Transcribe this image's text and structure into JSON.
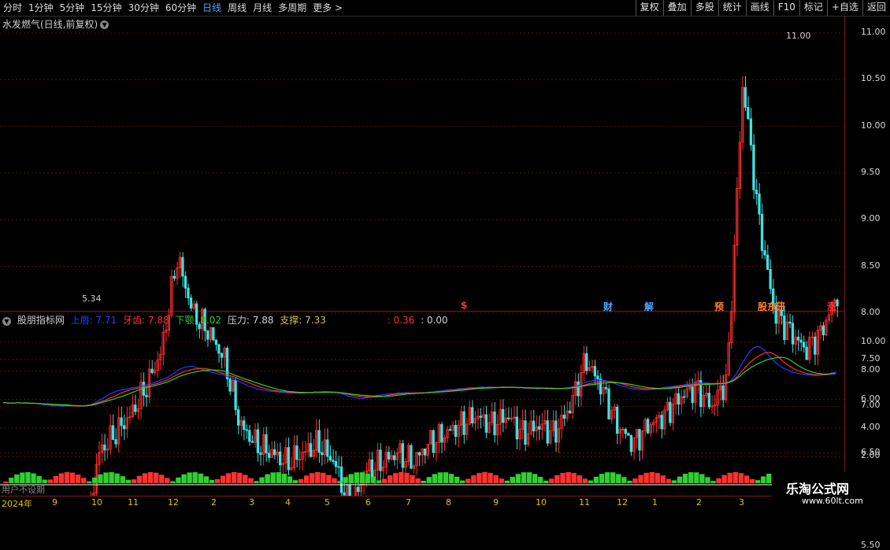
{
  "toolbar": {
    "periods": [
      "分时",
      "1分钟",
      "5分钟",
      "15分钟",
      "30分钟",
      "60分钟",
      "日线",
      "周线",
      "月线",
      "多周期",
      "更多 >"
    ],
    "active_period": "日线",
    "actions": [
      "复权",
      "叠加",
      "多股",
      "统计",
      "画线",
      "F10",
      "标记",
      "+自选",
      "返回"
    ]
  },
  "kline": {
    "title": "水发燃气(日线,前复权)",
    "high_label": "11.00",
    "low_label": "5.34",
    "y_ticks": [
      "11.00",
      "10.50",
      "10.00",
      "9.50",
      "9.00",
      "8.50",
      "8.00",
      "7.50",
      "7.00",
      "6.50",
      "6.00",
      "5.50"
    ],
    "markers": [
      {
        "text": "$",
        "color": "#ff3030"
      },
      {
        "text": "财",
        "color": "#4aa8ff"
      },
      {
        "text": "解",
        "color": "#4aa8ff"
      },
      {
        "text": "预",
        "color": "#ff8030"
      },
      {
        "text": "股东",
        "color": "#ff8030"
      },
      {
        "text": "研",
        "color": "#ff8030"
      },
      {
        "text": "涨",
        "color": "#ff3030"
      }
    ]
  },
  "indicator": {
    "name": "股朋指标网",
    "upper_lip_label": "上唇: 7.71",
    "teeth_label": "牙齿: 7.88",
    "lower_jaw_label": "下颚: 8.02",
    "pressure_label": "压力: 7.88",
    "support_label": "支撑: 7.33",
    "value1_label": ": 0.36",
    "value2_label": ": 0.00",
    "y_ticks": [
      "10.00",
      "8.00",
      "6.00",
      "4.00",
      "2.00"
    ],
    "colors": {
      "upper_lip": "#2040ff",
      "teeth": "#ff3030",
      "lower_jaw": "#30d030",
      "pressure": "#d0d0d0",
      "support": "#d0c060"
    }
  },
  "lower_left_text": "用户不设期",
  "date_axis": [
    "2024年",
    "9",
    "10",
    "11",
    "12",
    "2",
    "3",
    "4",
    "5",
    "6",
    "7",
    "8",
    "9",
    "10",
    "11",
    "12",
    "1",
    "2",
    "3"
  ],
  "watermark": {
    "title": "乐淘公式网",
    "url": "www.60lt.com"
  },
  "chart_data": {
    "type": "candlestick",
    "title": "水发燃气(日线,前复权)",
    "ylim": [
      5.3,
      11.2
    ],
    "highest": 11.0,
    "lowest": 5.34,
    "close_series_approx": [
      5.7,
      5.8,
      5.6,
      5.5,
      5.6,
      5.45,
      6.5,
      6.7,
      6.9,
      7.2,
      7.6,
      8.6,
      8.0,
      7.8,
      7.5,
      6.8,
      6.6,
      6.5,
      6.4,
      6.5,
      6.6,
      6.4,
      5.9,
      6.3,
      6.4,
      6.5,
      6.4,
      6.6,
      6.7,
      6.8,
      6.9,
      6.8,
      6.9,
      6.7,
      6.8,
      6.7,
      7.0,
      7.5,
      7.2,
      6.8,
      6.6,
      6.8,
      6.9,
      7.1,
      7.2,
      7.0,
      7.3,
      10.5,
      9.0,
      8.0,
      7.8,
      7.6,
      7.8,
      8.2
    ]
  }
}
